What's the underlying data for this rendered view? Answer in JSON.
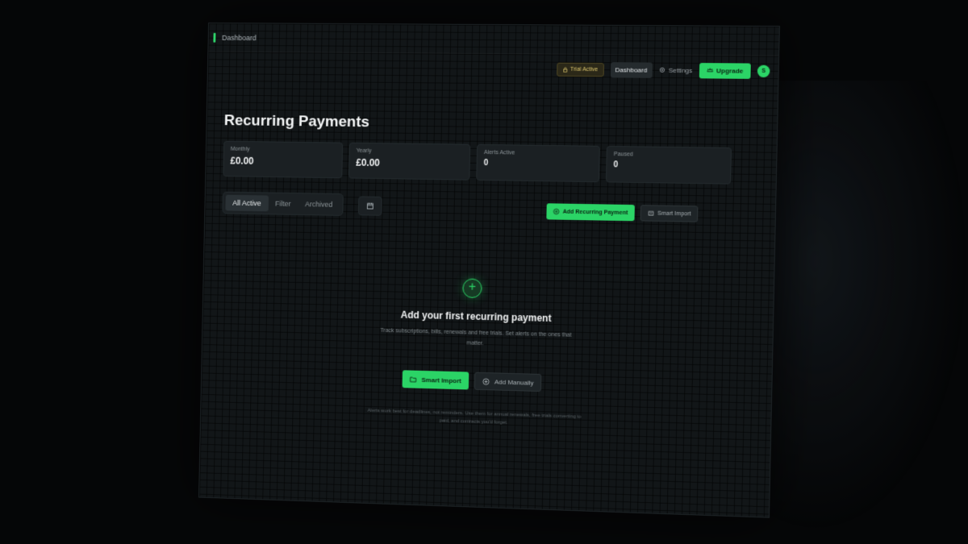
{
  "window": {
    "title": "Dashboard"
  },
  "nav": {
    "trial_label": "Trial Active",
    "dashboard_label": "Dashboard",
    "settings_label": "Settings",
    "upgrade_label": "Upgrade",
    "avatar_initial": "S"
  },
  "page": {
    "title": "Recurring Payments"
  },
  "stats": [
    {
      "label": "Monthly",
      "value": "£0.00"
    },
    {
      "label": "Yearly",
      "value": "£0.00"
    },
    {
      "label": "Alerts Active",
      "value": "0"
    },
    {
      "label": "Paused",
      "value": "0"
    }
  ],
  "tabs": [
    {
      "label": "All Active"
    },
    {
      "label": "Filter"
    },
    {
      "label": "Archived"
    }
  ],
  "actions": {
    "add_label": "Add Recurring Payment",
    "import_label": "Smart Import"
  },
  "empty_state": {
    "title": "Add your first recurring payment",
    "description": "Track subscriptions, bills, renewals and free trials. Set alerts on the ones that matter.",
    "smart_import_label": "Smart Import",
    "add_manually_label": "Add Manually",
    "footnote": "Alerts work best for deadlines, not reminders. Use them for annual renewals, free trials converting to paid, and contracts you'd forget."
  },
  "colors": {
    "accent": "#2bd466",
    "background": "#121618",
    "trial": "#d9c36b"
  }
}
